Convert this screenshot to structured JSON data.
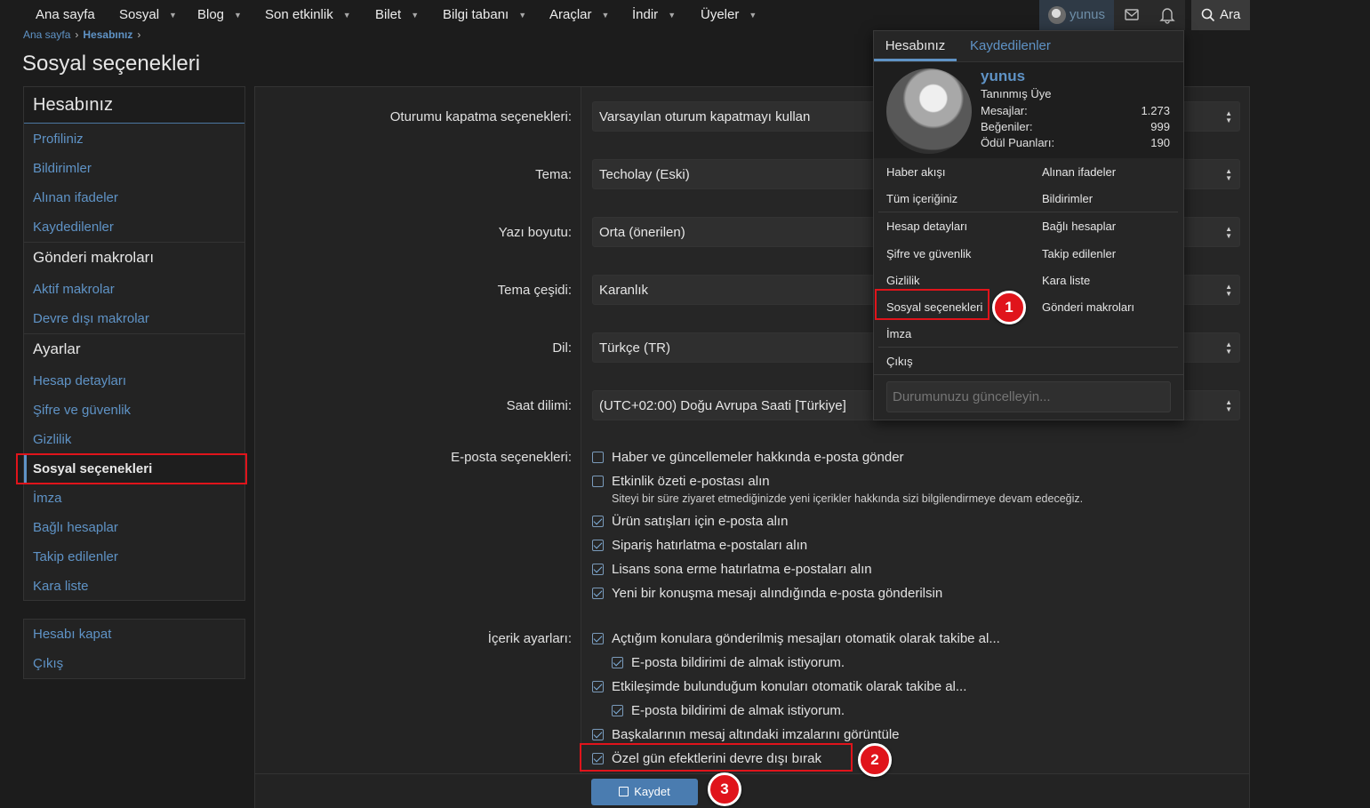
{
  "nav": {
    "items": [
      {
        "label": "Ana sayfa",
        "chevron": false
      },
      {
        "label": "Sosyal",
        "chevron": true
      },
      {
        "label": "Blog",
        "chevron": true
      },
      {
        "label": "Son etkinlik",
        "chevron": true
      },
      {
        "label": "Bilet",
        "chevron": true
      },
      {
        "label": "Bilgi tabanı",
        "chevron": true
      },
      {
        "label": "Araçlar",
        "chevron": true
      },
      {
        "label": "İndir",
        "chevron": true
      },
      {
        "label": "Üyeler",
        "chevron": true
      }
    ],
    "user": "yunus",
    "search": "Ara"
  },
  "breadcrumb": {
    "home": "Ana sayfa",
    "current": "Hesabınız"
  },
  "page_title": "Sosyal seçenekleri",
  "sidebar": {
    "head": "Hesabınız",
    "account": [
      "Profiliniz",
      "Bildirimler",
      "Alınan ifadeler",
      "Kaydedilenler"
    ],
    "macros_head": "Gönderi makroları",
    "macros": [
      "Aktif makrolar",
      "Devre dışı makrolar"
    ],
    "settings_head": "Ayarlar",
    "settings": [
      "Hesap detayları",
      "Şifre ve güvenlik",
      "Gizlilik",
      "Sosyal seçenekleri",
      "İmza",
      "Bağlı hesaplar",
      "Takip edilenler",
      "Kara liste"
    ],
    "bottom": [
      "Hesabı kapat",
      "Çıkış"
    ]
  },
  "form": {
    "selects": [
      {
        "label": "Oturumu kapatma seçenekleri:",
        "value": "Varsayılan oturum kapatmayı kullan"
      },
      {
        "label": "Tema:",
        "value": "Techolay (Eski)"
      },
      {
        "label": "Yazı boyutu:",
        "value": "Orta (önerilen)"
      },
      {
        "label": "Tema çeşidi:",
        "value": "Karanlık"
      },
      {
        "label": "Dil:",
        "value": "Türkçe (TR)"
      },
      {
        "label": "Saat dilimi:",
        "value": "(UTC+02:00) Doğu Avrupa Saati [Türkiye]"
      }
    ],
    "email_label": "E-posta seçenekleri:",
    "email_options": [
      {
        "label": "Haber ve güncellemeler hakkında e-posta gönder",
        "checked": false
      },
      {
        "label": "Etkinlik özeti e-postası alın",
        "checked": false
      },
      {
        "label": "Ürün satışları için e-posta alın",
        "checked": true
      },
      {
        "label": "Sipariş hatırlatma e-postaları alın",
        "checked": true
      },
      {
        "label": "Lisans sona erme hatırlatma e-postaları alın",
        "checked": true
      },
      {
        "label": "Yeni bir konuşma mesajı alındığında e-posta gönderilsin",
        "checked": true
      }
    ],
    "email_hint": "Siteyi bir süre ziyaret etmediğinizde yeni içerikler hakkında sizi bilgilendirmeye devam edeceğiz.",
    "content_label": "İçerik ayarları:",
    "content_options": [
      {
        "label": "Açtığım konulara gönderilmiş mesajları otomatik olarak takibe al...",
        "checked": true
      },
      {
        "label": "E-posta bildirimi de almak istiyorum.",
        "checked": true
      },
      {
        "label": "Etkileşimde bulunduğum konuları otomatik olarak takibe al...",
        "checked": true
      },
      {
        "label": "E-posta bildirimi de almak istiyorum.",
        "checked": true
      },
      {
        "label": "Başkalarının mesaj altındaki imzalarını görüntüle",
        "checked": true
      },
      {
        "label": "Özel gün efektlerini devre dışı bırak",
        "checked": true
      }
    ],
    "save": "Kaydet"
  },
  "dropdown": {
    "tabs": [
      "Hesabınız",
      "Kaydedilenler"
    ],
    "username": "yunus",
    "role": "Tanınmış Üye",
    "stats": [
      {
        "label": "Mesajlar:",
        "value": "1.273"
      },
      {
        "label": "Beğeniler:",
        "value": "999"
      },
      {
        "label": "Ödül Puanları:",
        "value": "190"
      }
    ],
    "links": [
      "Haber akışı",
      "Alınan ifadeler",
      "Tüm içeriğiniz",
      "Bildirimler",
      "Hesap detayları",
      "Bağlı hesaplar",
      "Şifre ve güvenlik",
      "Takip edilenler",
      "Gizlilik",
      "Kara liste",
      "Sosyal seçenekleri",
      "Gönderi makroları",
      "İmza",
      "Çıkış"
    ],
    "status_placeholder": "Durumunuzu güncelleyin..."
  },
  "annotations": [
    "1",
    "2",
    "3"
  ],
  "colors": {
    "accent": "#5f93c6",
    "highlight": "#e0141b",
    "button": "#4a7cb0"
  }
}
